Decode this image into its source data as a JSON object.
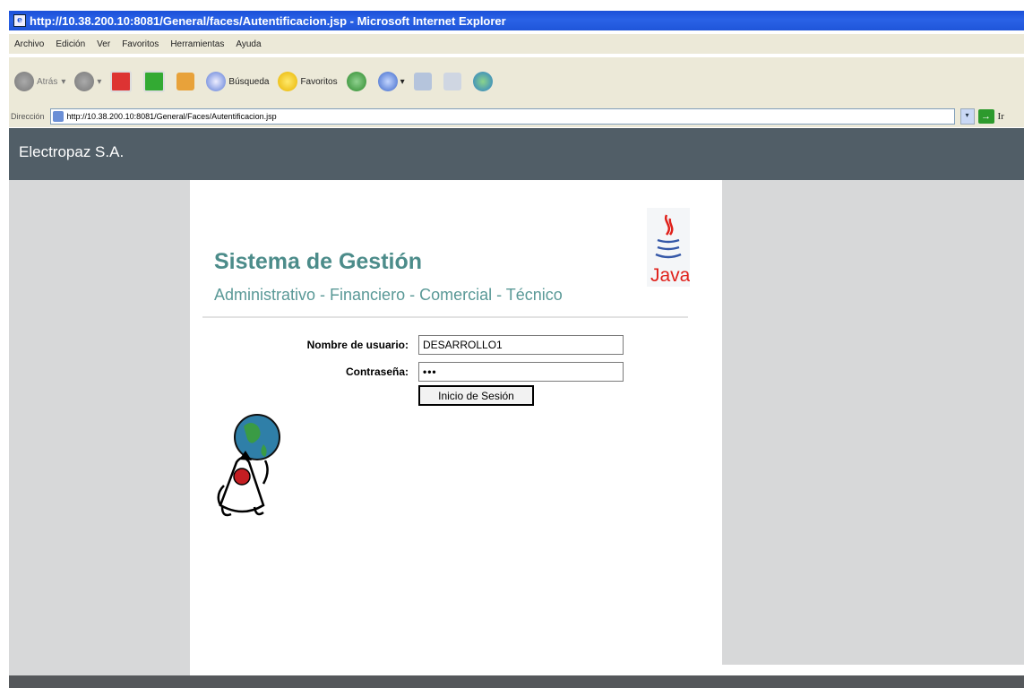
{
  "window": {
    "title": "http://10.38.200.10:8081/General/faces/Autentificacion.jsp - Microsoft Internet Explorer"
  },
  "menu": [
    "Archivo",
    "Edición",
    "Ver",
    "Favoritos",
    "Herramientas",
    "Ayuda"
  ],
  "toolbar": {
    "back": "Atrás",
    "search": "Búsqueda",
    "favorites": "Favoritos"
  },
  "address": {
    "label": "Dirección",
    "url": "http://10.38.200.10:8081/General/Faces/Autentificacion.jsp",
    "go": "Ir"
  },
  "header": {
    "org": "Electropaz S.A."
  },
  "login": {
    "title": "Sistema de Gestión",
    "subtitle": "Administrativo - Financiero - Comercial - Técnico",
    "username_label": "Nombre de usuario:",
    "username_value": "DESARROLLO1",
    "password_label": "Contraseña:",
    "password_value": "•••",
    "submit": "Inicio de Sesión",
    "java_text": "Java"
  },
  "colors": {
    "header_bg": "#515e67",
    "title_color": "#4c8c8a",
    "side_bg": "#d7d8d9"
  }
}
